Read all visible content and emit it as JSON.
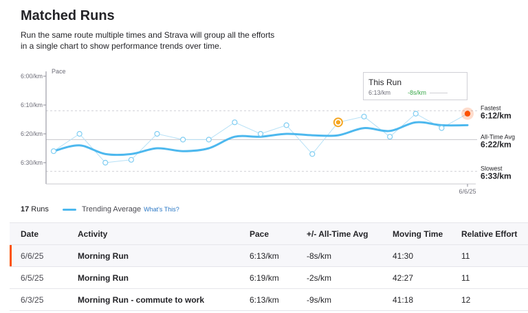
{
  "page": {
    "title": "Matched Runs",
    "description": "Run the same route multiple times and Strava will group all the efforts in a single chart to show performance trends over time."
  },
  "colors": {
    "trend": "#4db8ee",
    "points": "#7fcdf2",
    "this_run": "#f5a623",
    "fastest": "#fc5200",
    "brand": "#fc5200"
  },
  "chart_data": {
    "type": "line",
    "y_axis_label": "Pace",
    "y_ticks": [
      "6:00/km",
      "6:10/km",
      "6:20/km",
      "6:30/km"
    ],
    "y_tick_seconds": [
      360,
      370,
      380,
      390
    ],
    "x_end_label": "6/6/25",
    "series": [
      {
        "name": "Runs",
        "pace_seconds": [
          386,
          380,
          390,
          389,
          380,
          382,
          382,
          376,
          380,
          377,
          387,
          376,
          374,
          381,
          373,
          378,
          373
        ]
      },
      {
        "name": "Trending Average",
        "pace_seconds": [
          386,
          384,
          387,
          387,
          385,
          386,
          385,
          381,
          381,
          380,
          380.5,
          380.5,
          378,
          379,
          376,
          377,
          377
        ]
      }
    ],
    "this_run_index": 11,
    "fastest_index": 16,
    "reference_lines": {
      "fastest": {
        "label": "Fastest",
        "value": "6:12/km",
        "seconds": 372
      },
      "average": {
        "label": "All-Time Avg",
        "value": "6:22/km",
        "seconds": 382
      },
      "slowest": {
        "label": "Slowest",
        "value": "6:33/km",
        "seconds": 393
      }
    },
    "tooltip": {
      "title": "This Run",
      "pace": "6:13/km",
      "diff": "-8s/km"
    }
  },
  "legend": {
    "count": "17",
    "runs_label": "Runs",
    "trend_label": "Trending Average",
    "help_label": "What's This?"
  },
  "table": {
    "headers": [
      "Date",
      "Activity",
      "Pace",
      "+/- All-Time Avg",
      "Moving Time",
      "Relative Effort"
    ],
    "rows": [
      {
        "date": "6/6/25",
        "activity": "Morning Run",
        "pace": "6:13/km",
        "diff": "-8s/km",
        "time": "41:30",
        "effort": "11"
      },
      {
        "date": "6/5/25",
        "activity": "Morning Run",
        "pace": "6:19/km",
        "diff": "-2s/km",
        "time": "42:27",
        "effort": "11"
      },
      {
        "date": "6/3/25",
        "activity": "Morning Run - commute to work",
        "pace": "6:13/km",
        "diff": "-9s/km",
        "time": "41:18",
        "effort": "12"
      }
    ]
  }
}
